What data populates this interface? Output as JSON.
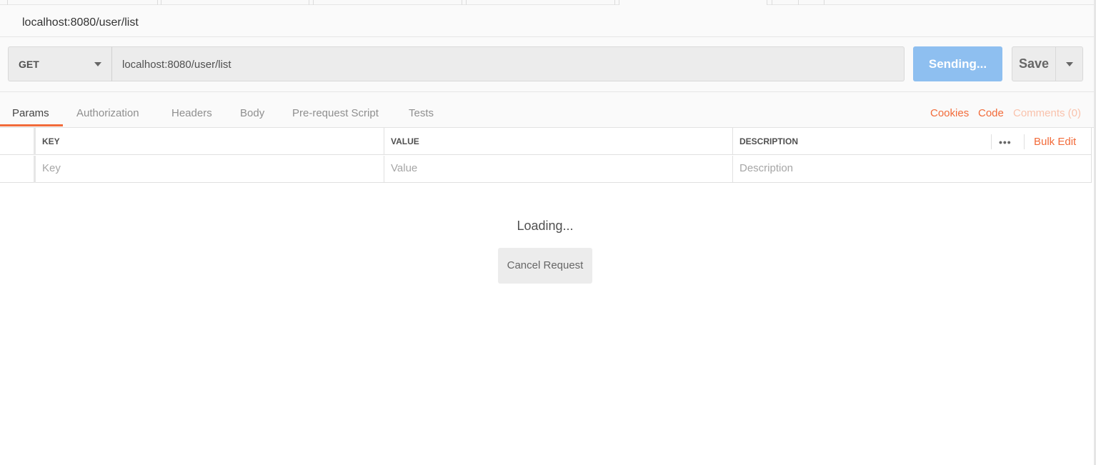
{
  "title": "localhost:8080/user/list",
  "request": {
    "method": "GET",
    "url": "localhost:8080/user/list",
    "send_label": "Sending...",
    "save_label": "Save"
  },
  "tabs": [
    {
      "label": "Params",
      "active": true
    },
    {
      "label": "Authorization"
    },
    {
      "label": "Headers"
    },
    {
      "label": "Body"
    },
    {
      "label": "Pre-request Script"
    },
    {
      "label": "Tests"
    }
  ],
  "right_links": {
    "cookies": "Cookies",
    "code": "Code",
    "comments": "Comments (0)"
  },
  "params_table": {
    "headers": {
      "key": "KEY",
      "value": "VALUE",
      "description": "DESCRIPTION"
    },
    "placeholders": {
      "key": "Key",
      "value": "Value",
      "description": "Description"
    },
    "more": "•••",
    "bulk_edit": "Bulk Edit"
  },
  "loading": {
    "text": "Loading...",
    "cancel_label": "Cancel Request"
  },
  "colors": {
    "accent": "#f26b3a",
    "send_button": "#8ebff0"
  }
}
